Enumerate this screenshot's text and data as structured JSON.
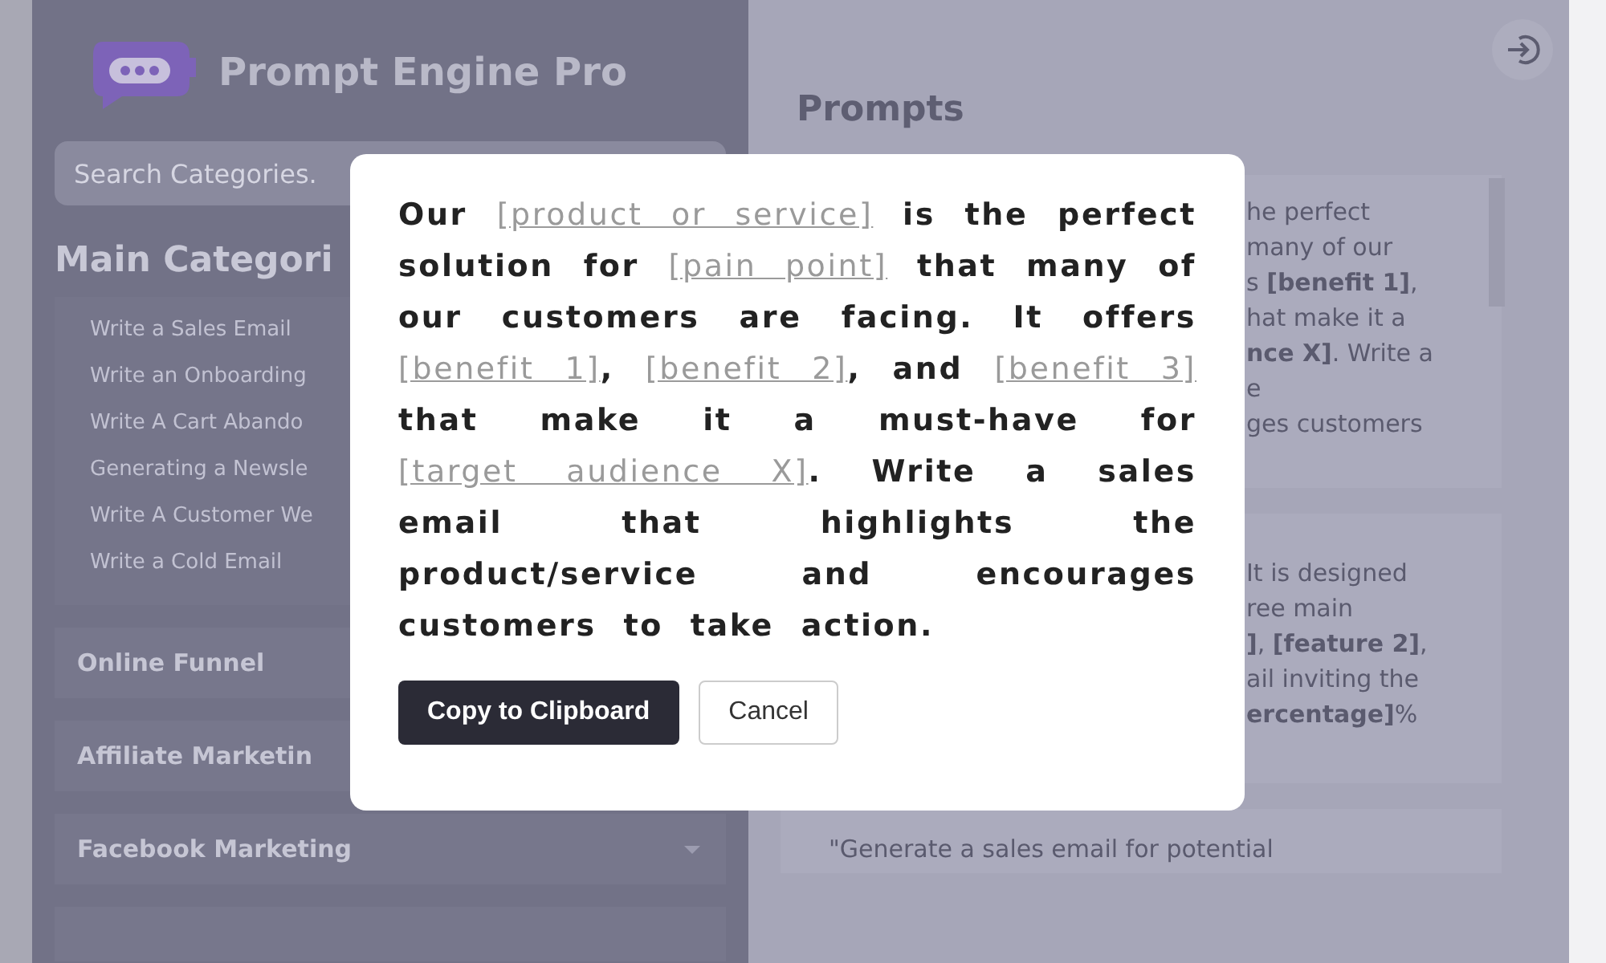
{
  "sidebar": {
    "title": "Prompt Engine Pro",
    "search": {
      "placeholder": "Search Categories."
    },
    "main_category": {
      "title": "Main Categori",
      "items": [
        "Write a Sales Email",
        "Write an Onboarding",
        "Write A Cart Abando",
        "Generating a Newsle",
        "Write A Customer We",
        "Write a Cold Email"
      ]
    },
    "sections": [
      {
        "label": "Online Funnel"
      },
      {
        "label": "Affiliate Marketin"
      },
      {
        "label": "Facebook Marketing",
        "caret": true
      }
    ]
  },
  "main": {
    "title": "Prompts",
    "cards": [
      {
        "lines": [
          "he perfect",
          "many of our",
          "s **[benefit 1]**,",
          "hat make it a",
          "**nce X]**. Write a",
          "e",
          "ges customers"
        ]
      },
      {
        "lines": [
          "It is designed",
          "ree main",
          "**]**, **[feature 2]**,",
          "ail inviting the",
          "**ercentage]**%"
        ]
      },
      {
        "lines": [
          "\"Generate a sales email for potential"
        ]
      }
    ]
  },
  "modal": {
    "segments": [
      {
        "kind": "text",
        "text": "Our "
      },
      {
        "kind": "placeholder",
        "text": "[product or service]"
      },
      {
        "kind": "text",
        "text": " is the perfect solution for "
      },
      {
        "kind": "placeholder",
        "text": "[pain point]"
      },
      {
        "kind": "text",
        "text": " that many of our customers are facing. It offers "
      },
      {
        "kind": "placeholder",
        "text": "[benefit 1]"
      },
      {
        "kind": "text",
        "text": ", "
      },
      {
        "kind": "placeholder",
        "text": "[benefit 2]"
      },
      {
        "kind": "text",
        "text": ", and "
      },
      {
        "kind": "placeholder",
        "text": "[benefit 3]"
      },
      {
        "kind": "text",
        "text": " that make it a must-have for "
      },
      {
        "kind": "placeholder",
        "text": "[target audience X]"
      },
      {
        "kind": "text",
        "text": ". Write a sales email that highlights the product/service and encourages customers to take action."
      }
    ],
    "buttons": [
      {
        "label": "Copy to Clipboard",
        "kind": "primary"
      },
      {
        "label": "Cancel",
        "kind": "secondary"
      }
    ]
  }
}
